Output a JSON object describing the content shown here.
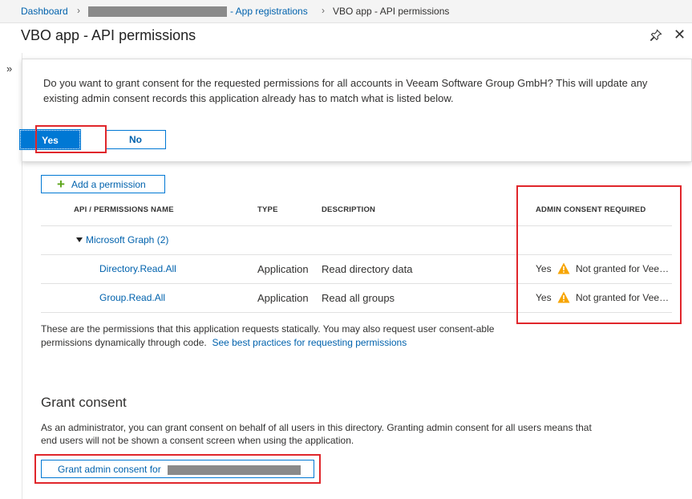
{
  "breadcrumb": {
    "home": "Dashboard",
    "app_registrations": "- App registrations",
    "current": "VBO app - API permissions"
  },
  "blade": {
    "title": "VBO app - API permissions",
    "pin_icon": "pin-icon",
    "close_icon": "close-icon",
    "expand_icon": "»"
  },
  "consent_dialog": {
    "message": "Do you want to grant consent for the requested permissions for all accounts in Veeam Software Group GmbH? This will update any existing admin consent records this application already has to match what is listed below.",
    "yes_label": "Yes",
    "no_label": "No"
  },
  "toolbar": {
    "add_permission_label": "Add a permission",
    "add_icon": "+"
  },
  "table": {
    "columns": [
      "API / PERMISSIONS NAME",
      "TYPE",
      "DESCRIPTION",
      "ADMIN CONSENT REQUIRED"
    ],
    "group": {
      "name": "Microsoft Graph (2)",
      "expanded": true
    },
    "rows": [
      {
        "name": "Directory.Read.All",
        "type": "Application",
        "description": "Read directory data",
        "admin_consent": "Yes",
        "status": "Not granted for Veeam Software Group GmbH"
      },
      {
        "name": "Group.Read.All",
        "type": "Application",
        "description": "Read all groups",
        "admin_consent": "Yes",
        "status": "Not granted for Veeam Software Group GmbH"
      }
    ]
  },
  "static_note": {
    "text": "These are the permissions that this application requests statically. You may also request user consent-able permissions dynamically through code.",
    "link": "See best practices for requesting permissions"
  },
  "grant_consent": {
    "heading": "Grant consent",
    "text": "As an administrator, you can grant consent on behalf of all users in this directory. Granting admin consent for all users means that end users will not be shown a consent screen when using the application.",
    "button_label": "Grant admin consent for"
  },
  "colors": {
    "accent": "#0078d4",
    "link": "#0062ad",
    "highlight": "#e0262b",
    "warning": "#f7a500",
    "add_icon": "#5ca51a"
  }
}
